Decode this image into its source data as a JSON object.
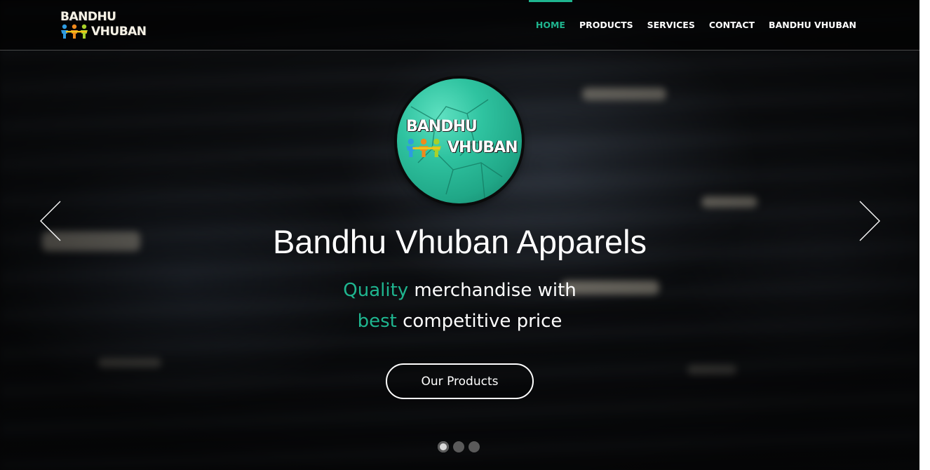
{
  "brand": {
    "line1": "BANDHU",
    "line2": "VHUBAN"
  },
  "nav": {
    "items": [
      {
        "label": "HOME",
        "active": true
      },
      {
        "label": "PRODUCTS",
        "active": false
      },
      {
        "label": "SERVICES",
        "active": false
      },
      {
        "label": "CONTACT",
        "active": false
      },
      {
        "label": "BANDHU VHUBAN",
        "active": false
      }
    ]
  },
  "hero": {
    "logo_line1": "BANDHU",
    "logo_line2": "VHUBAN",
    "title": "Bandhu Vhuban Apparels",
    "subtitle_line1_accent": "Quality",
    "subtitle_line1_rest": " merchandise with",
    "subtitle_line2_accent": "best",
    "subtitle_line2_rest": " competitive price",
    "cta_label": "Our Products"
  },
  "carousel": {
    "slides_count": 3,
    "active_index": 0,
    "prev_icon": "chevron-left-icon",
    "next_icon": "chevron-right-icon"
  },
  "colors": {
    "accent": "#1fb58f",
    "text": "#ffffff",
    "logo_teal": "#2fc3a0"
  }
}
